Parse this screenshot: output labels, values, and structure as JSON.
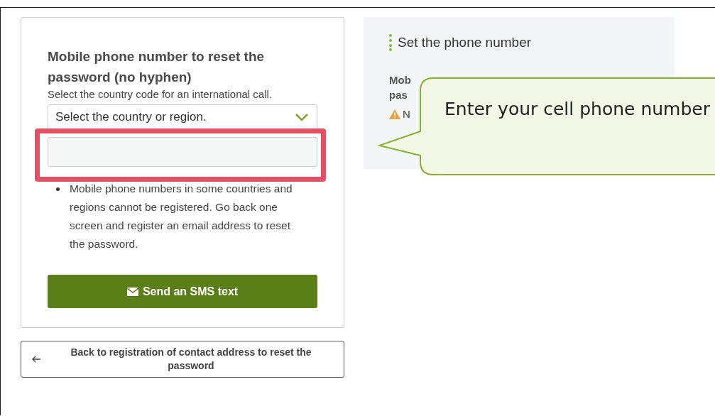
{
  "form": {
    "title": "Mobile phone number to reset the password (no hyphen)",
    "hint": "Select the country code for an international call.",
    "country_select": {
      "value": "Select the country or region."
    },
    "notes": [
      "Mobile phone numbers in some countries and regions cannot be registered. Go back one screen and register an email address to reset the password."
    ],
    "submit_button": "Send an SMS text"
  },
  "back_button": "Back to registration of contact address to reset the password",
  "side_panel": {
    "title": "Set the phone number",
    "label_lines": [
      "Mob",
      "pas"
    ],
    "warning": "N"
  },
  "callout": {
    "text": "Enter your cell phone number"
  }
}
